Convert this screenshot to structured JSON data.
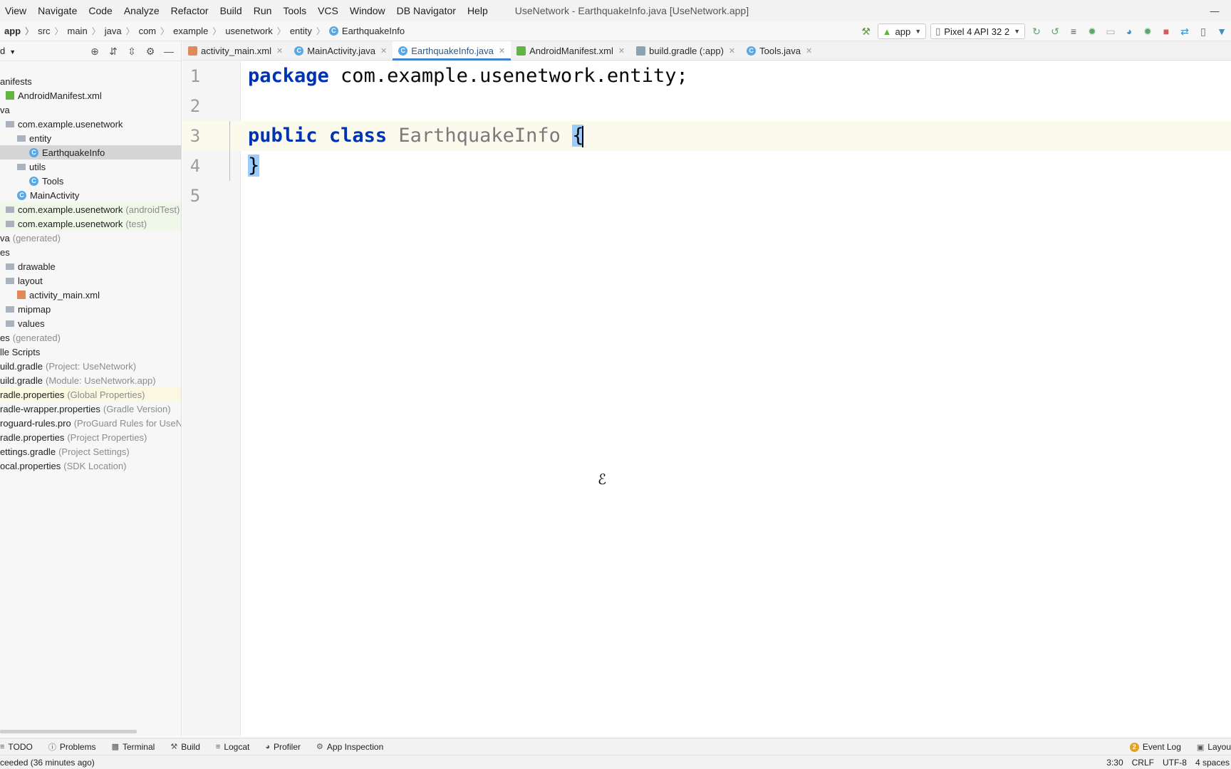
{
  "menubar": {
    "items": [
      "View",
      "Navigate",
      "Code",
      "Analyze",
      "Refactor",
      "Build",
      "Run",
      "Tools",
      "VCS",
      "Window",
      "DB Navigator",
      "Help"
    ],
    "window_title": "UseNetwork - EarthquakeInfo.java [UseNetwork.app]"
  },
  "navbar": {
    "breadcrumbs": [
      "app",
      "src",
      "main",
      "java",
      "com",
      "example",
      "usenetwork",
      "entity",
      "EarthquakeInfo"
    ],
    "run_config": "app",
    "device": "Pixel 4 API 32 2"
  },
  "project_panel": {
    "title": "d",
    "tree": [
      {
        "label": "anifests",
        "hint": "",
        "indent": 0,
        "icon": "none",
        "style": ""
      },
      {
        "label": "AndroidManifest.xml",
        "hint": "",
        "indent": 8,
        "icon": "manifest",
        "style": ""
      },
      {
        "label": "va",
        "hint": "",
        "indent": 0,
        "icon": "none",
        "style": ""
      },
      {
        "label": "com.example.usenetwork",
        "hint": "",
        "indent": 8,
        "icon": "package",
        "style": ""
      },
      {
        "label": "entity",
        "hint": "",
        "indent": 24,
        "icon": "folder",
        "style": ""
      },
      {
        "label": "EarthquakeInfo",
        "hint": "",
        "indent": 41,
        "icon": "class",
        "style": "selected"
      },
      {
        "label": "utils",
        "hint": "",
        "indent": 24,
        "icon": "folder",
        "style": ""
      },
      {
        "label": "Tools",
        "hint": "",
        "indent": 41,
        "icon": "class",
        "style": ""
      },
      {
        "label": "MainActivity",
        "hint": "",
        "indent": 24,
        "icon": "class",
        "style": ""
      },
      {
        "label": "com.example.usenetwork",
        "hint": "(androidTest)",
        "indent": 8,
        "icon": "package",
        "style": "test"
      },
      {
        "label": "com.example.usenetwork",
        "hint": "(test)",
        "indent": 8,
        "icon": "package",
        "style": "test"
      },
      {
        "label": "va",
        "hint": "(generated)",
        "indent": 0,
        "icon": "none",
        "style": ""
      },
      {
        "label": "es",
        "hint": "",
        "indent": 0,
        "icon": "none",
        "style": ""
      },
      {
        "label": "drawable",
        "hint": "",
        "indent": 8,
        "icon": "package",
        "style": ""
      },
      {
        "label": "layout",
        "hint": "",
        "indent": 8,
        "icon": "package",
        "style": ""
      },
      {
        "label": "activity_main.xml",
        "hint": "",
        "indent": 24,
        "icon": "xml",
        "style": ""
      },
      {
        "label": "mipmap",
        "hint": "",
        "indent": 8,
        "icon": "package",
        "style": ""
      },
      {
        "label": "values",
        "hint": "",
        "indent": 8,
        "icon": "package",
        "style": ""
      },
      {
        "label": "es",
        "hint": "(generated)",
        "indent": 0,
        "icon": "none",
        "style": ""
      },
      {
        "label": "lle Scripts",
        "hint": "",
        "indent": 0,
        "icon": "none",
        "style": ""
      },
      {
        "label": "uild.gradle",
        "hint": "(Project: UseNetwork)",
        "indent": 0,
        "icon": "none",
        "style": ""
      },
      {
        "label": "uild.gradle",
        "hint": "(Module: UseNetwork.app)",
        "indent": 0,
        "icon": "none",
        "style": ""
      },
      {
        "label": "radle.properties",
        "hint": "(Global Properties)",
        "indent": 0,
        "icon": "none",
        "style": "highlight"
      },
      {
        "label": "radle-wrapper.properties",
        "hint": "(Gradle Version)",
        "indent": 0,
        "icon": "none",
        "style": ""
      },
      {
        "label": "roguard-rules.pro",
        "hint": "(ProGuard Rules for UseN",
        "indent": 0,
        "icon": "none",
        "style": ""
      },
      {
        "label": "radle.properties",
        "hint": "(Project Properties)",
        "indent": 0,
        "icon": "none",
        "style": ""
      },
      {
        "label": "ettings.gradle",
        "hint": "(Project Settings)",
        "indent": 0,
        "icon": "none",
        "style": ""
      },
      {
        "label": "ocal.properties",
        "hint": "(SDK Location)",
        "indent": 0,
        "icon": "none",
        "style": ""
      }
    ]
  },
  "tabs": [
    {
      "label": "activity_main.xml",
      "icon": "xml",
      "active": false
    },
    {
      "label": "MainActivity.java",
      "icon": "class",
      "active": false
    },
    {
      "label": "EarthquakeInfo.java",
      "icon": "class",
      "active": true
    },
    {
      "label": "AndroidManifest.xml",
      "icon": "manifest",
      "active": false
    },
    {
      "label": "build.gradle (:app)",
      "icon": "gradle",
      "active": false
    },
    {
      "label": "Tools.java",
      "icon": "class",
      "active": false
    }
  ],
  "editor": {
    "line_numbers": [
      "1",
      "2",
      "3",
      "4",
      "5"
    ],
    "line1": {
      "keyword": "package",
      "rest": " com.example.usenetwork.entity;"
    },
    "line3": {
      "kw1": "public",
      "kw2": "class",
      "classname": "EarthquakeInfo",
      "brace": "{"
    },
    "line4": {
      "brace": "}"
    }
  },
  "tool_windows": {
    "left": [
      "TODO",
      "Problems",
      "Terminal",
      "Build",
      "Logcat",
      "Profiler",
      "App Inspection"
    ],
    "event_log": "Event Log",
    "event_count": "2",
    "layout": "Layou"
  },
  "statusbar": {
    "message": "ceeded (36 minutes ago)",
    "position": "3:30",
    "line_sep": "CRLF",
    "encoding": "UTF-8",
    "indent": "4 spaces"
  }
}
